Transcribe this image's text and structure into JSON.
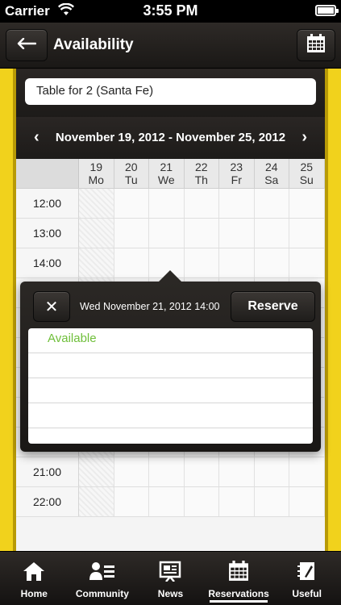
{
  "status": {
    "carrier": "Carrier",
    "time": "3:55 PM"
  },
  "navbar": {
    "title": "Availability"
  },
  "filter": {
    "table": "Table for 2 (Santa Fe)"
  },
  "week": {
    "range": "November 19, 2012 - November 25, 2012"
  },
  "days": [
    {
      "num": "19",
      "name": "Mo"
    },
    {
      "num": "20",
      "name": "Tu"
    },
    {
      "num": "21",
      "name": "We"
    },
    {
      "num": "22",
      "name": "Th"
    },
    {
      "num": "23",
      "name": "Fr"
    },
    {
      "num": "24",
      "name": "Sa"
    },
    {
      "num": "25",
      "name": "Su"
    }
  ],
  "times_top": [
    "12:00",
    "13:00",
    "14:00"
  ],
  "times_bottom": [
    "21:00",
    "22:00"
  ],
  "popover": {
    "slot": "Wed November 21, 2012 14:00",
    "reserve_label": "Reserve",
    "items": [
      "Available",
      "",
      "",
      "",
      ""
    ]
  },
  "tabs": [
    {
      "label": "Home",
      "icon": "home-icon"
    },
    {
      "label": "Community",
      "icon": "community-icon"
    },
    {
      "label": "News",
      "icon": "news-icon"
    },
    {
      "label": "Reservations",
      "icon": "reservations-icon",
      "active": true
    },
    {
      "label": "Useful",
      "icon": "useful-icon"
    }
  ]
}
